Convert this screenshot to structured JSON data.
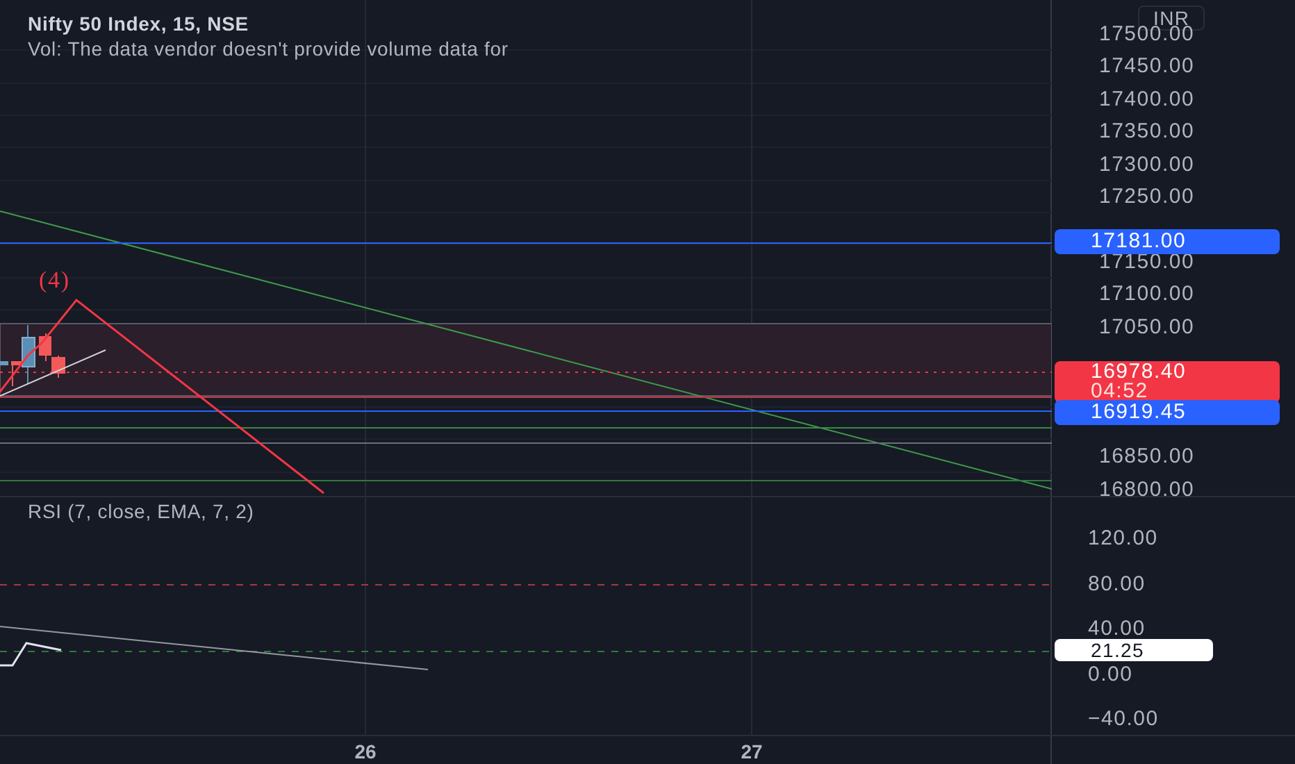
{
  "legend": {
    "title": "Nifty 50 Index, 15, NSE",
    "volume_note": "Vol: The data vendor doesn't provide volume data for"
  },
  "price_axis": {
    "currency": "INR",
    "labels": [
      "17500.00",
      "17450.00",
      "17400.00",
      "17350.00",
      "17300.00",
      "17250.00",
      "17150.00",
      "17100.00",
      "17050.00",
      "16850.00",
      "16800.00"
    ],
    "markers": [
      {
        "kind": "level",
        "value": "17181.00",
        "color": "#2962ff"
      },
      {
        "kind": "last",
        "value": "16978.40",
        "countdown": "04:52",
        "color": "#f23645"
      },
      {
        "kind": "level",
        "value": "16919.45",
        "color": "#2962ff"
      }
    ]
  },
  "annotation": {
    "label": "(4)"
  },
  "rsi": {
    "title": "RSI (7, close, EMA, 7, 2)",
    "labels": [
      "120.00",
      "80.00",
      "40.00",
      "0.00",
      "−40.00"
    ],
    "value": "21.25"
  },
  "time_axis": {
    "labels": [
      "26",
      "27"
    ]
  }
}
